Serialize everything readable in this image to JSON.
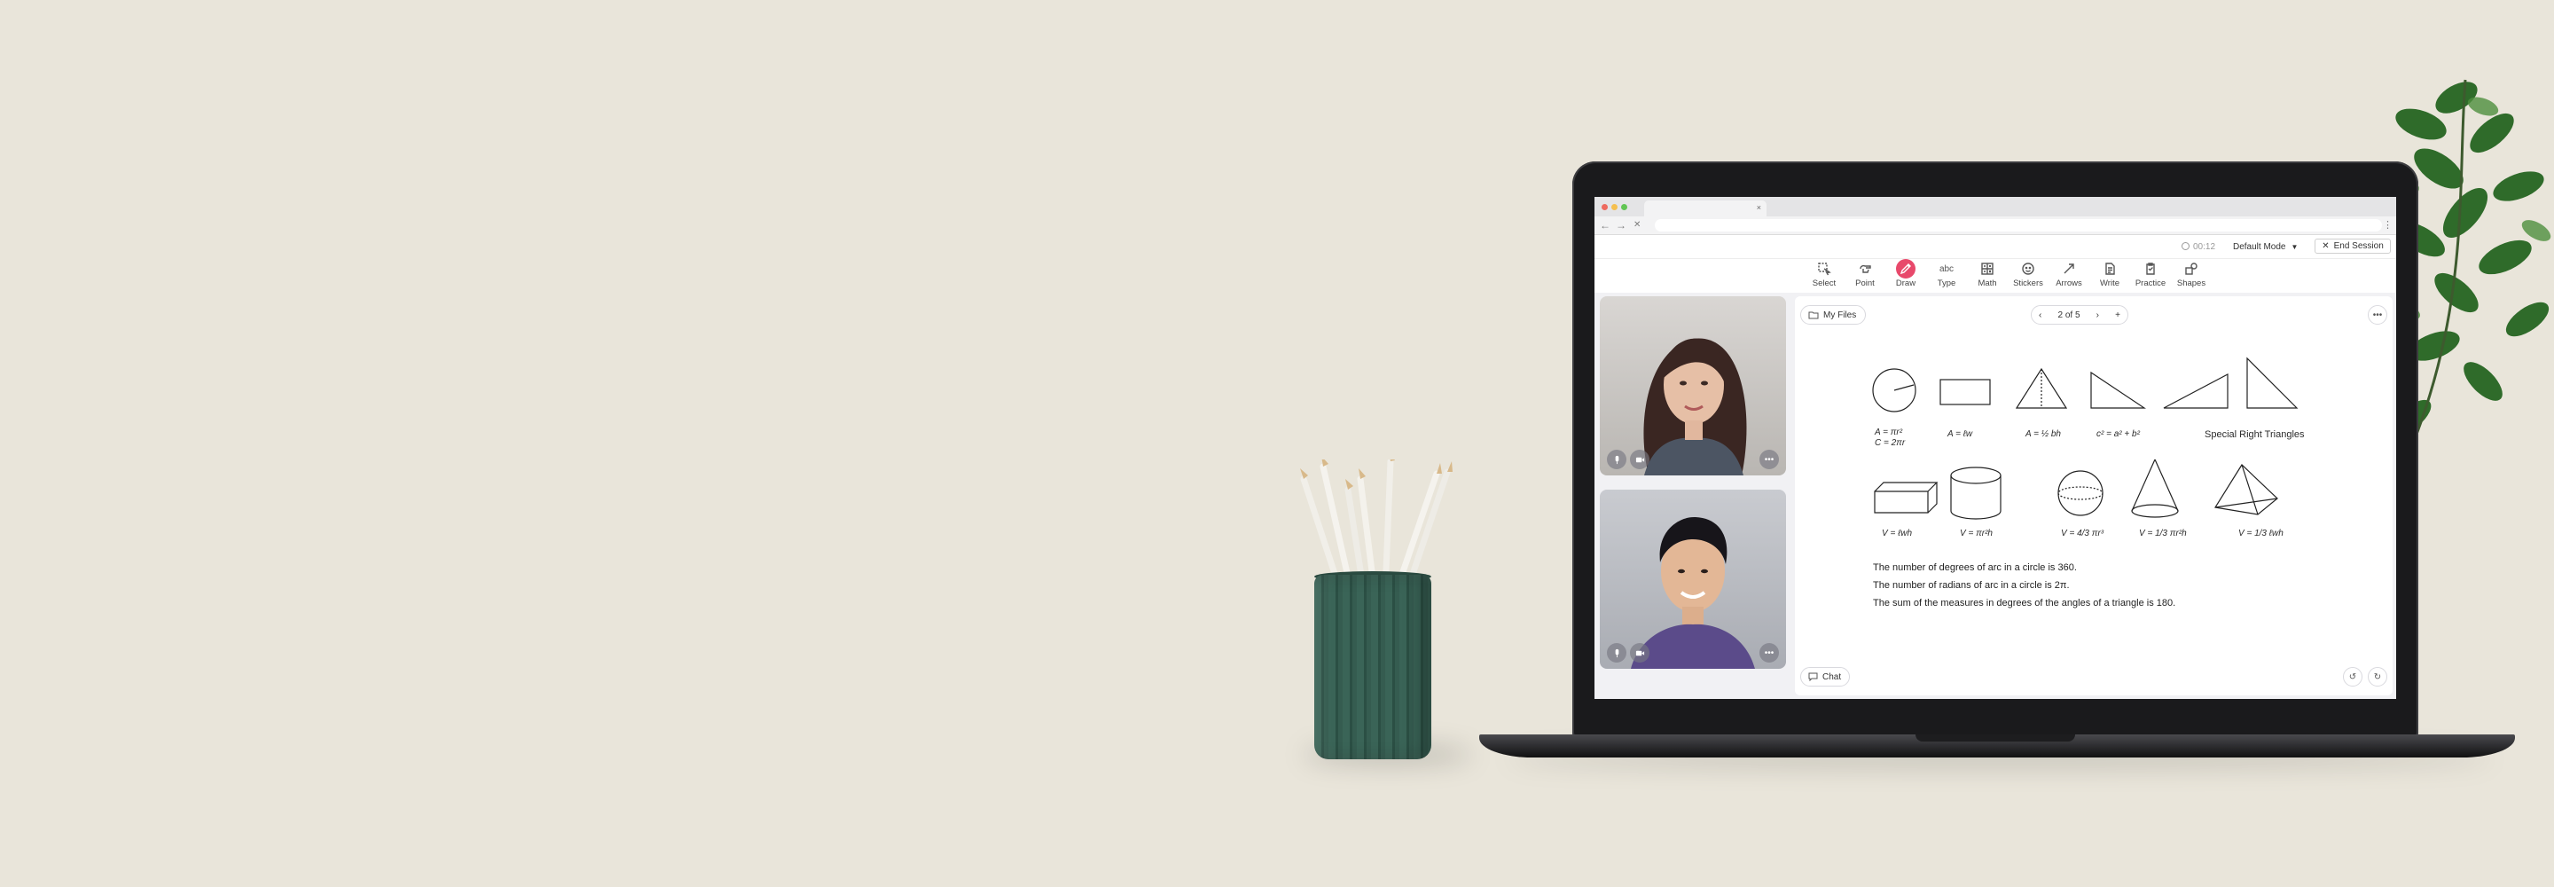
{
  "browser": {
    "tab_close": "×",
    "nav": {
      "back": "←",
      "forward": "→",
      "stop": "✕"
    },
    "menu": "⋮"
  },
  "session": {
    "timer": "00:12",
    "mode": "Default Mode",
    "end_session": "End Session"
  },
  "tools": [
    {
      "label": "Select",
      "icon": "select-icon"
    },
    {
      "label": "Point",
      "icon": "pointer-hand-icon"
    },
    {
      "label": "Draw",
      "icon": "pen-icon",
      "active": true
    },
    {
      "label": "Type",
      "icon": "text-abc-icon"
    },
    {
      "label": "Math",
      "icon": "math-icon"
    },
    {
      "label": "Stickers",
      "icon": "sticker-icon"
    },
    {
      "label": "Arrows",
      "icon": "arrow-icon"
    },
    {
      "label": "Write",
      "icon": "document-icon"
    },
    {
      "label": "Practice",
      "icon": "clipboard-icon"
    },
    {
      "label": "Shapes",
      "icon": "shapes-icon"
    }
  ],
  "board": {
    "my_files": "My Files",
    "pager": "2 of 5",
    "chat": "Chat",
    "formula_labels": {
      "circle": [
        "A = πr²",
        "C = 2πr"
      ],
      "rect": "A = ℓw",
      "triangle": "A = ½ bh",
      "pythag": "c² = a² + b²",
      "special": "Special Right Triangles",
      "box": "V = ℓwh",
      "cylinder": "V = πr²h",
      "sphere": "V = 4/3 πr³",
      "cone": "V = 1/3 πr²h",
      "pyramid": "V = 1/3 ℓwh"
    },
    "facts": [
      "The number of degrees of arc in a circle is 360.",
      "The number of radians of arc in a circle is 2π.",
      "The sum of the measures in degrees of the angles of a triangle is 180."
    ]
  },
  "colors": {
    "accent": "#e8496b",
    "background": "#e9e5da"
  }
}
